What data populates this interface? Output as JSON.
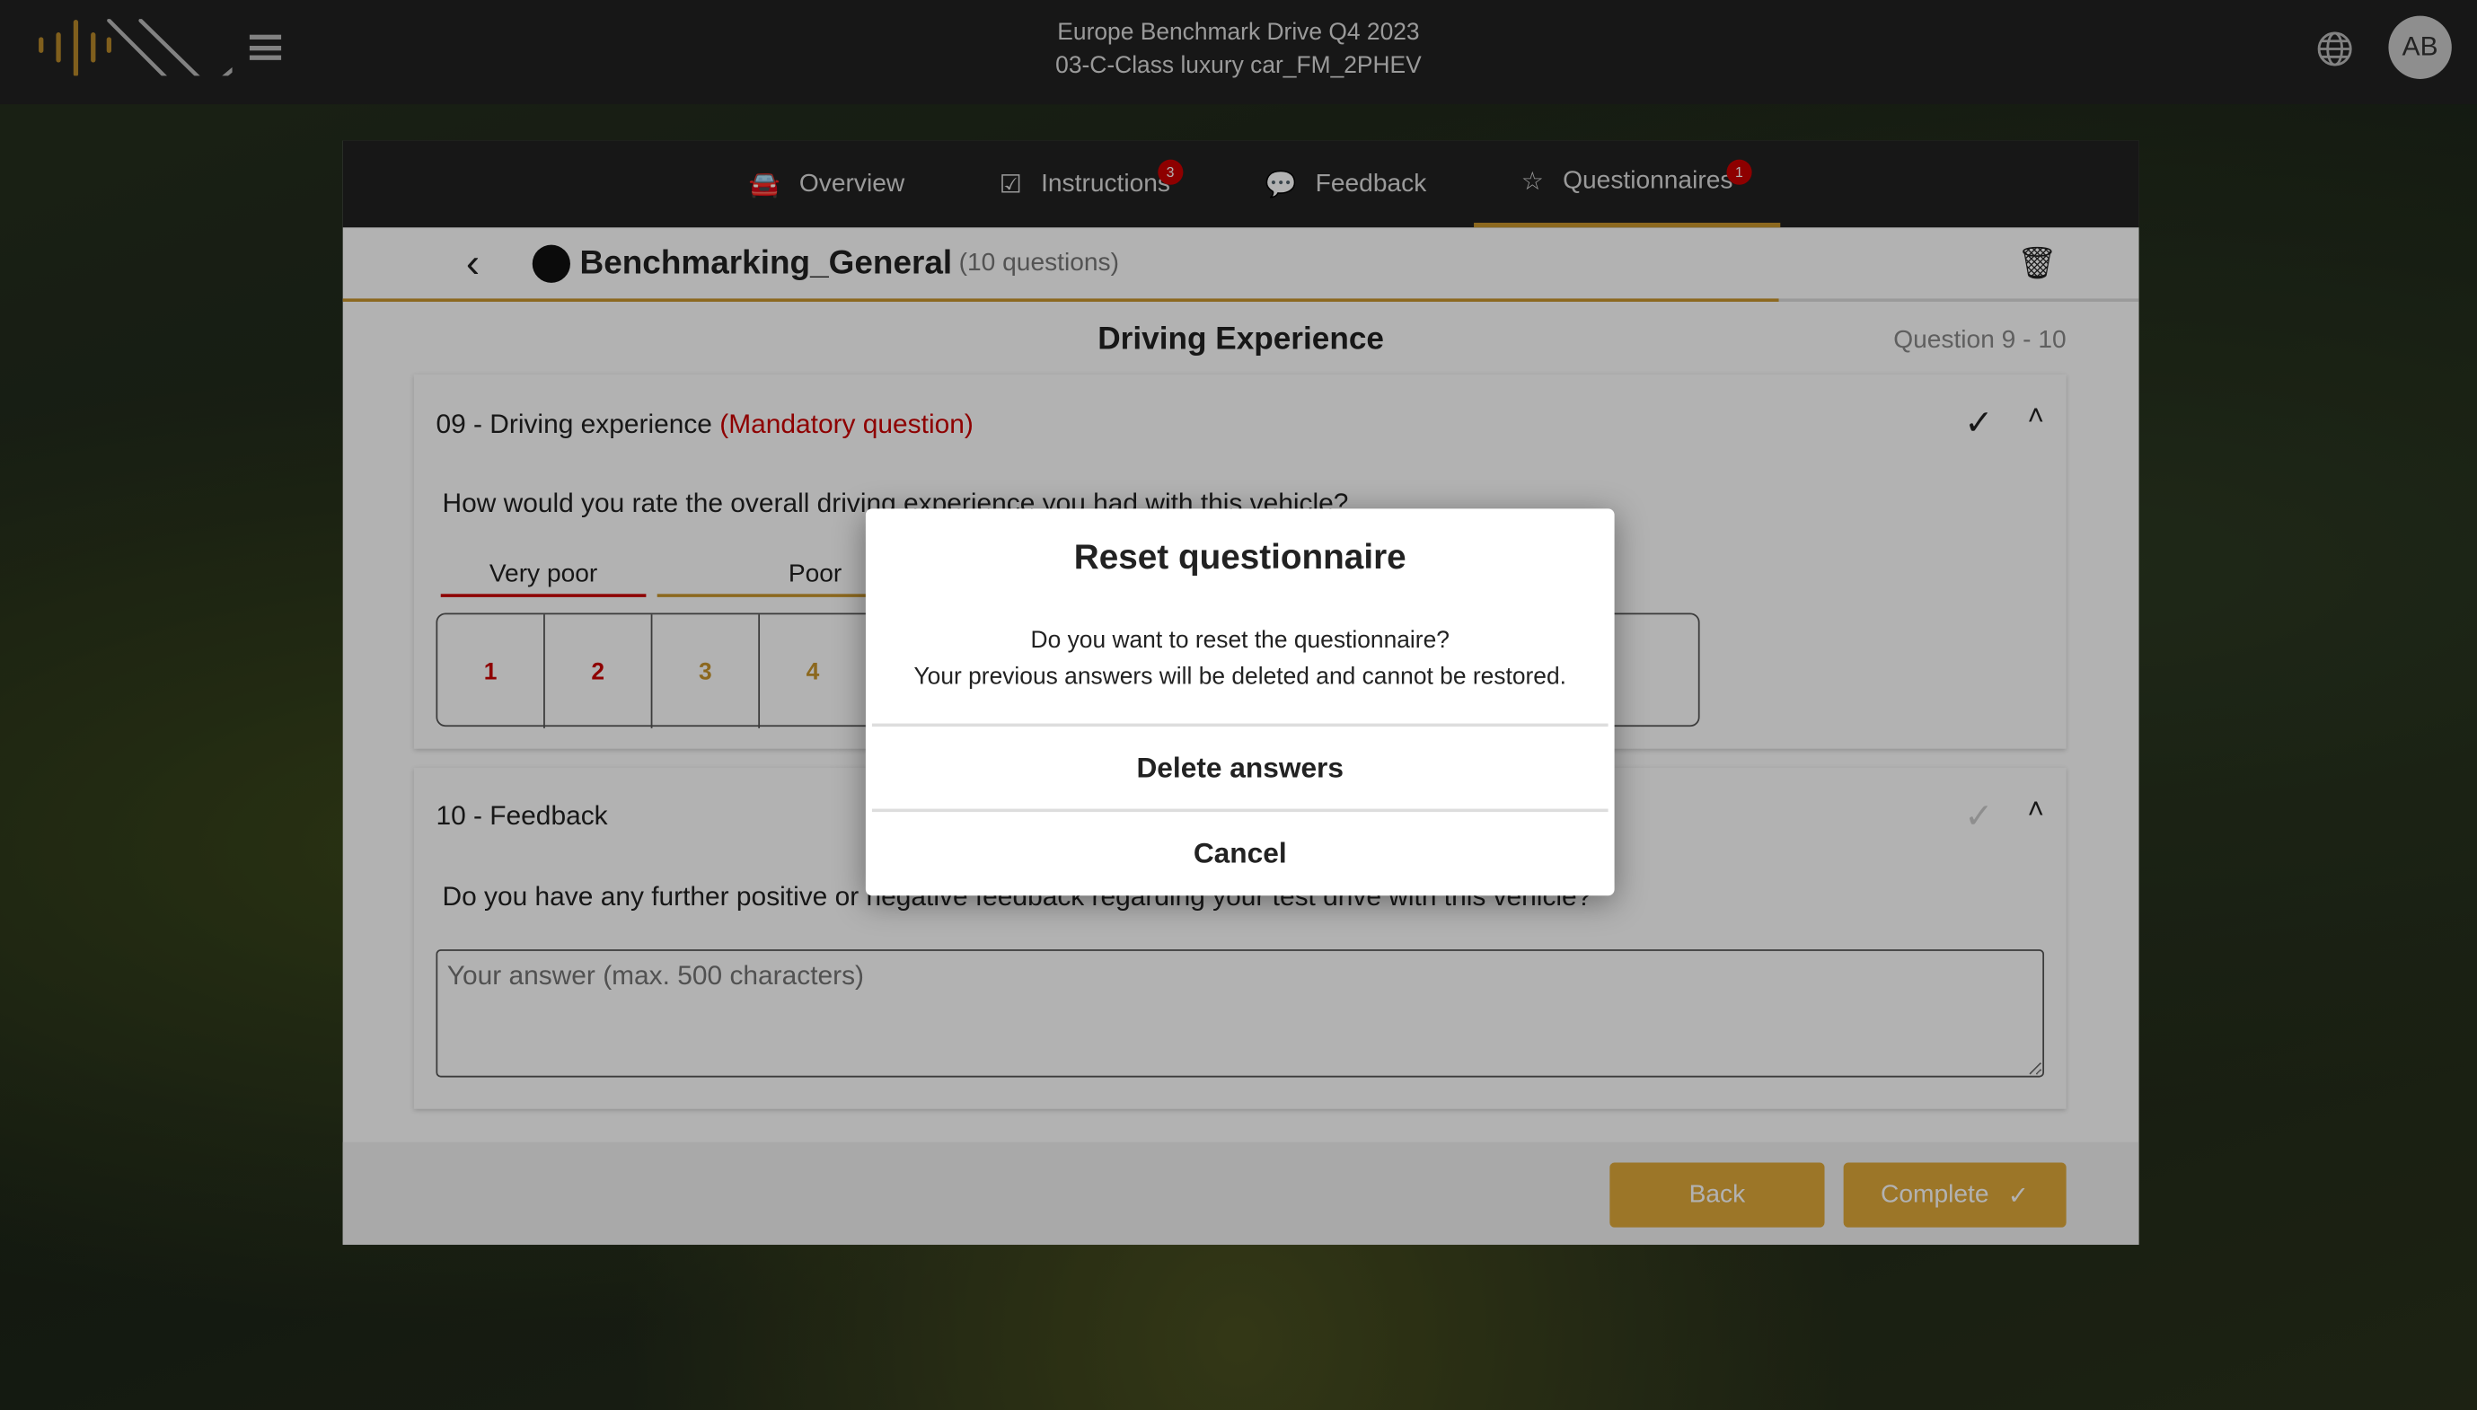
{
  "header": {
    "title_line1": "Europe Benchmark Drive Q4 2023",
    "title_line2": "03-C-Class luxury car_FM_2PHEV",
    "avatar": "AB",
    "accent": "#c9962b"
  },
  "tabs": [
    {
      "label": "Overview",
      "icon": "car-icon"
    },
    {
      "label": "Instructions",
      "icon": "checklist-icon",
      "badge": "3"
    },
    {
      "label": "Feedback",
      "icon": "feedback-icon"
    },
    {
      "label": "Questionnaires",
      "icon": "star-icon",
      "badge": "1",
      "active": true
    }
  ],
  "questionnaire": {
    "name": "Benchmarking_General",
    "count": "(10 questions)",
    "section": "Driving Experience",
    "range": "Question 9 - 10"
  },
  "q9": {
    "title": "09 - Driving experience",
    "mandatory": "(Mandatory question)",
    "text": "How would you rate the overall driving experience you had with this vehicle?",
    "labels": [
      "Very poor",
      "Poor"
    ],
    "options": [
      "1",
      "2",
      "3",
      "4"
    ]
  },
  "q10": {
    "title": "10 - Feedback",
    "text": "Do you have any further positive or negative feedback regarding your test drive with this vehicle?",
    "placeholder": "Your answer (max. 500 characters)"
  },
  "footer": {
    "back": "Back",
    "complete": "Complete"
  },
  "modal": {
    "title": "Reset questionnaire",
    "line1": "Do you want to reset the questionnaire?",
    "line2": "Your previous answers will be deleted and cannot be restored.",
    "delete": "Delete answers",
    "cancel": "Cancel"
  }
}
